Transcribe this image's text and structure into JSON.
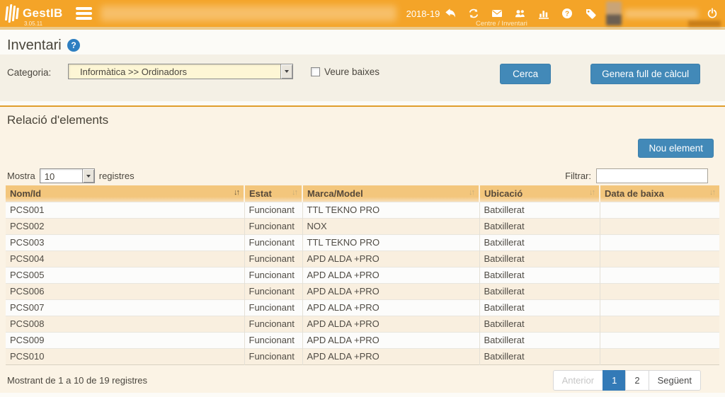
{
  "header": {
    "app_name": "GestIB",
    "version": "3.05.11",
    "school_year": "2018-19",
    "breadcrumb": "Centre / Inventari",
    "icons": [
      "reply-icon",
      "refresh-icon",
      "mail-icon",
      "users-icon",
      "bar-chart-icon",
      "help-circle-icon",
      "tag-icon",
      "power-icon"
    ]
  },
  "page": {
    "title": "Inventari"
  },
  "filters": {
    "category_label": "Categoria:",
    "category_value": "Informàtica >> Ordinadors",
    "show_disposals_label": "Veure baixes",
    "search_button": "Cerca",
    "spreadsheet_button": "Genera full de càlcul"
  },
  "section": {
    "title": "Relació d'elements",
    "new_element_button": "Nou element",
    "show_label": "Mostra",
    "show_value": "10",
    "records_label": "registres",
    "filter_label": "Filtrar:"
  },
  "table": {
    "columns": [
      {
        "label": "Nom/Id",
        "sorted": true
      },
      {
        "label": "Estat",
        "sorted": false
      },
      {
        "label": "Marca/Model",
        "sorted": false
      },
      {
        "label": "Ubicació",
        "sorted": false
      },
      {
        "label": "Data de baixa",
        "sorted": false
      }
    ],
    "rows": [
      {
        "id": "PCS001",
        "estat": "Funcionant",
        "marca": "TTL TEKNO PRO",
        "ubicacio": "Batxillerat",
        "baixa": ""
      },
      {
        "id": "PCS002",
        "estat": "Funcionant",
        "marca": "NOX",
        "ubicacio": "Batxillerat",
        "baixa": ""
      },
      {
        "id": "PCS003",
        "estat": "Funcionant",
        "marca": "TTL TEKNO PRO",
        "ubicacio": "Batxillerat",
        "baixa": ""
      },
      {
        "id": "PCS004",
        "estat": "Funcionant",
        "marca": "APD ALDA +PRO",
        "ubicacio": "Batxillerat",
        "baixa": ""
      },
      {
        "id": "PCS005",
        "estat": "Funcionant",
        "marca": "APD ALDA +PRO",
        "ubicacio": "Batxillerat",
        "baixa": ""
      },
      {
        "id": "PCS006",
        "estat": "Funcionant",
        "marca": "APD ALDA +PRO",
        "ubicacio": "Batxillerat",
        "baixa": ""
      },
      {
        "id": "PCS007",
        "estat": "Funcionant",
        "marca": "APD ALDA +PRO",
        "ubicacio": "Batxillerat",
        "baixa": ""
      },
      {
        "id": "PCS008",
        "estat": "Funcionant",
        "marca": "APD ALDA +PRO",
        "ubicacio": "Batxillerat",
        "baixa": ""
      },
      {
        "id": "PCS009",
        "estat": "Funcionant",
        "marca": "APD ALDA +PRO",
        "ubicacio": "Batxillerat",
        "baixa": ""
      },
      {
        "id": "PCS010",
        "estat": "Funcionant",
        "marca": "APD ALDA +PRO",
        "ubicacio": "Batxillerat",
        "baixa": ""
      }
    ]
  },
  "footer": {
    "summary": "Mostrant de 1 a 10 de 19 registres",
    "pagination": {
      "prev": "Anterior",
      "page1": "1",
      "page2": "2",
      "next": "Següent",
      "active": "1"
    }
  },
  "colors": {
    "header_orange": "#F4A428",
    "header_underline": "#ECCA8C",
    "button_blue": "#4289B8",
    "active_page_blue": "#337AB7",
    "table_header_tan": "#F3C67C",
    "panel_cream": "#FBF3E5",
    "help_icon_blue": "#2E7FC1",
    "category_field_cream": "#FDF6D5"
  }
}
